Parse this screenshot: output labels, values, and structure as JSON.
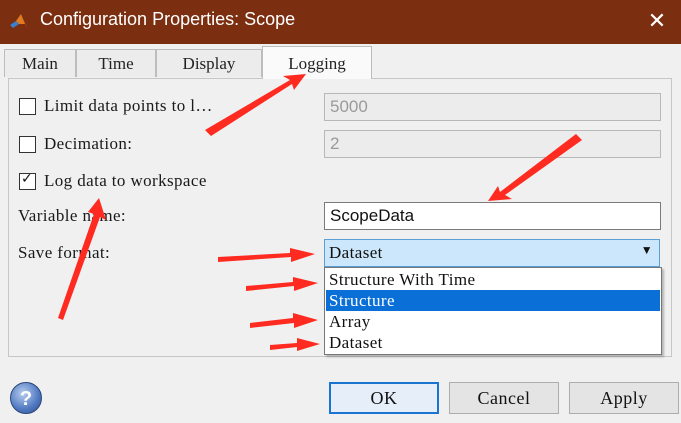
{
  "window": {
    "title": "Configuration Properties: Scope",
    "close_glyph": "✕",
    "colors": {
      "titlebar": "#7b2f10",
      "annotation_arrow": "#ff2a20",
      "selection": "#0a6fd6"
    }
  },
  "tabs": [
    {
      "label": "Main"
    },
    {
      "label": "Time"
    },
    {
      "label": "Display"
    },
    {
      "label": "Logging",
      "active": true
    }
  ],
  "logging": {
    "limit_data_points": {
      "label": "Limit data points to l…",
      "checked": false,
      "value": "5000"
    },
    "decimation": {
      "label": "Decimation:",
      "checked": false,
      "value": "2"
    },
    "log_to_workspace": {
      "label": "Log data to workspace",
      "checked": true,
      "check_glyph": "✓"
    },
    "variable_name": {
      "label": "Variable name:",
      "value": "ScopeData"
    },
    "save_format": {
      "label": "Save format:",
      "value": "Dataset",
      "options": [
        "Structure With Time",
        "Structure",
        "Array",
        "Dataset"
      ],
      "highlighted": "Structure",
      "arrow_glyph": "▼"
    }
  },
  "buttons": {
    "help": "?",
    "ok": "OK",
    "cancel": "Cancel",
    "apply": "Apply"
  },
  "icons": {
    "app": "matlab-icon",
    "help": "help-icon",
    "close": "close-icon"
  }
}
